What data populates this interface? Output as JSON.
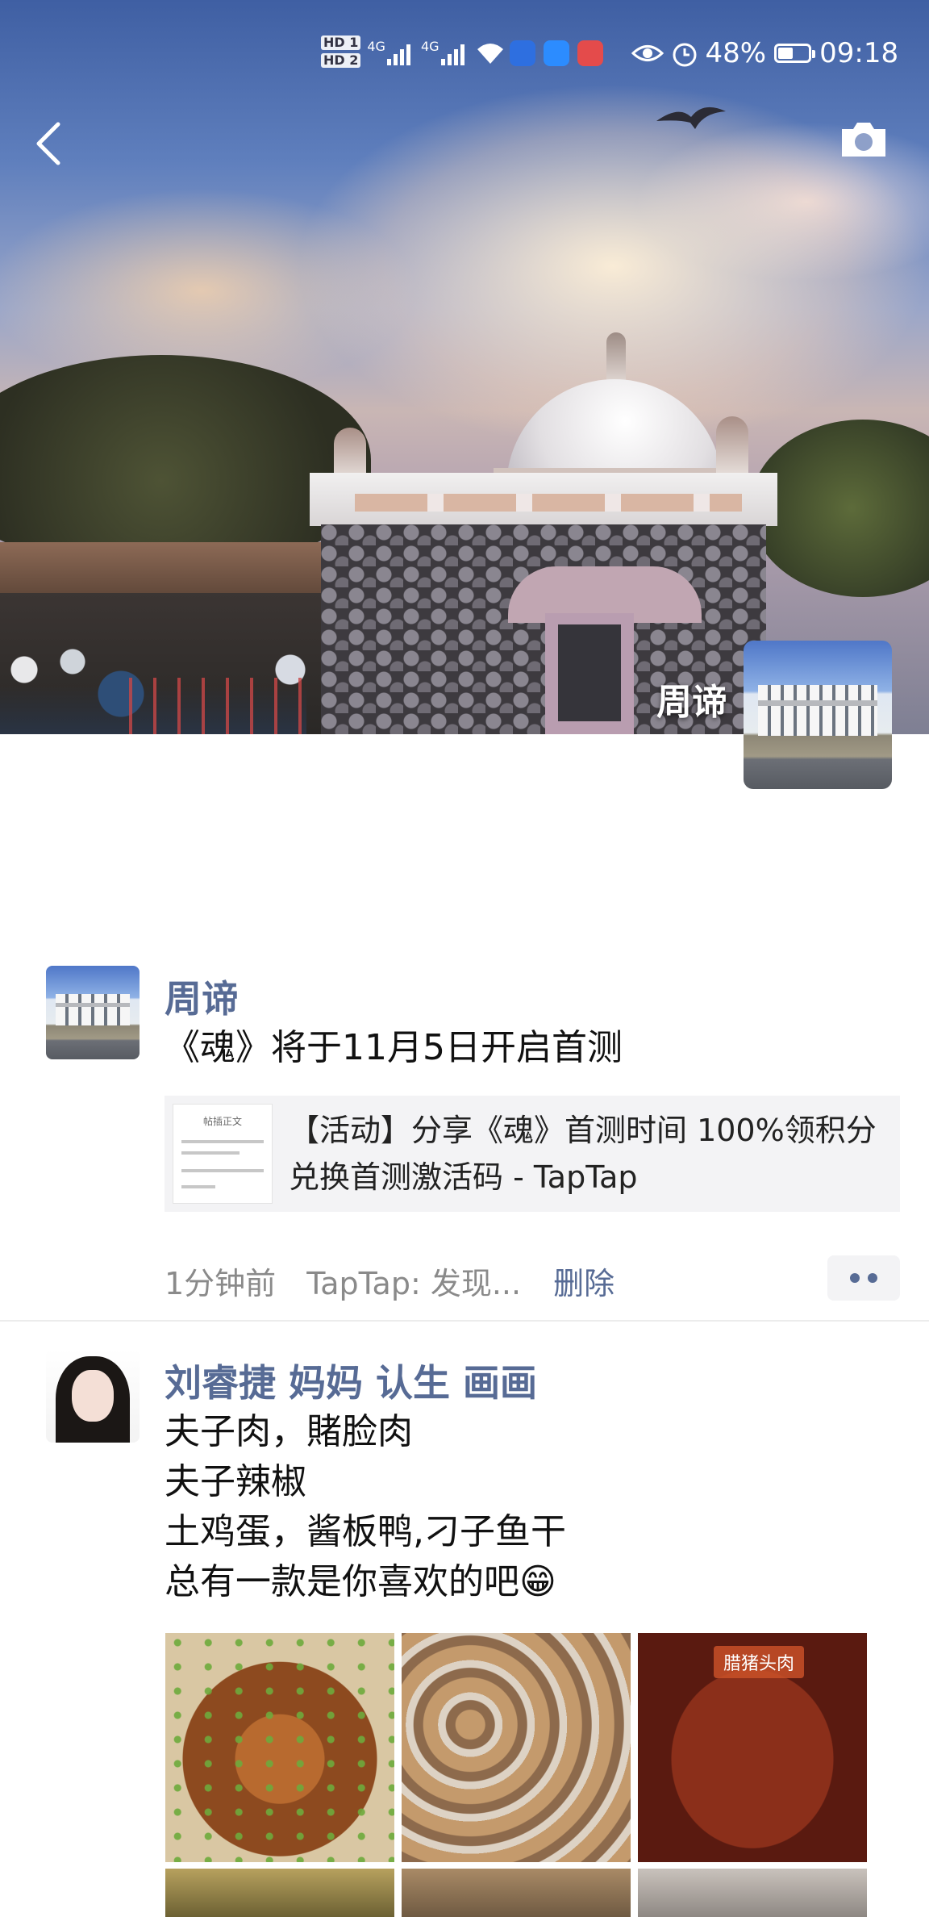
{
  "status_bar": {
    "sim1_label": "HD 1",
    "sim2_label": "HD 2",
    "network1": "4G",
    "network2": "4G",
    "battery": "48%",
    "time": "09:18",
    "icons": [
      "signal-icon",
      "wifi-icon",
      "app-icon",
      "weather-icon",
      "book-icon",
      "eye-icon",
      "alarm-icon",
      "battery-icon"
    ]
  },
  "header": {
    "back_icon": "chevron-left-icon",
    "camera_icon": "camera-icon",
    "owner_name": "周谛"
  },
  "posts": [
    {
      "author": "周谛",
      "text": "《魂》将于11月5日开启首测",
      "link_card": {
        "title": "【活动】分享《魂》首测时间 100%领积分兑换首测激活码 - TapTap",
        "thumb_title": "帖插正文"
      },
      "time": "1分钟前",
      "source": "TapTap: 发现...",
      "delete_label": "删除"
    },
    {
      "author": "刘睿捷 妈妈 认生 画画",
      "lines": [
        "夫子肉，賭脸肉",
        "夫子辣椒",
        "土鸡蛋，酱板鸭,刁子鱼干",
        "总有一款是你喜欢的吧😁"
      ],
      "image_tag": "腊猪头肉"
    }
  ],
  "colors": {
    "name_blue": "#576b95",
    "text": "#111111",
    "meta_gray": "#8a8a8a",
    "card_bg": "#f3f3f5"
  }
}
